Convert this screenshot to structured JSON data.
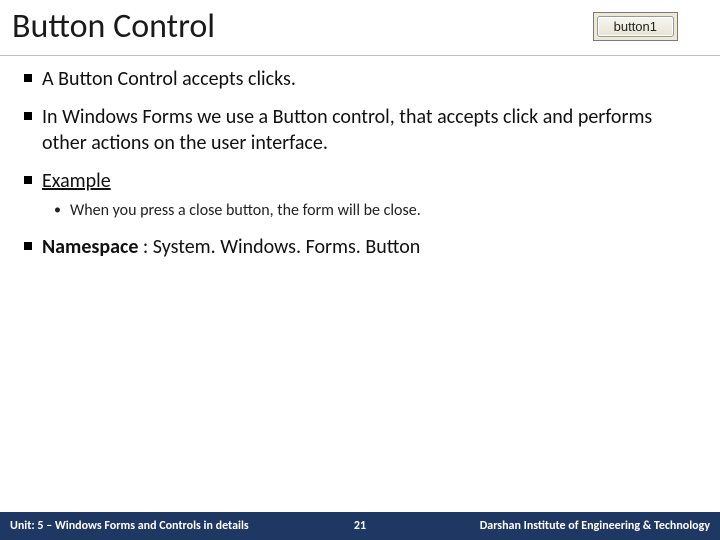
{
  "header": {
    "title": "Button Control",
    "button_label": "button1"
  },
  "bullets": {
    "b0": "A Button Control accepts clicks.",
    "b1": "In Windows Forms we use a Button control, that accepts click and performs other actions on the user interface.",
    "b2": "Example",
    "b2_sub": "When you press a close button, the form will be close.",
    "b3_label": "Namespace",
    "b3_rest": " : System. Windows. Forms. Button"
  },
  "footer": {
    "left": "Unit: 5 – Windows Forms and Controls in details",
    "center": "21",
    "right": "Darshan Institute of Engineering & Technology"
  }
}
